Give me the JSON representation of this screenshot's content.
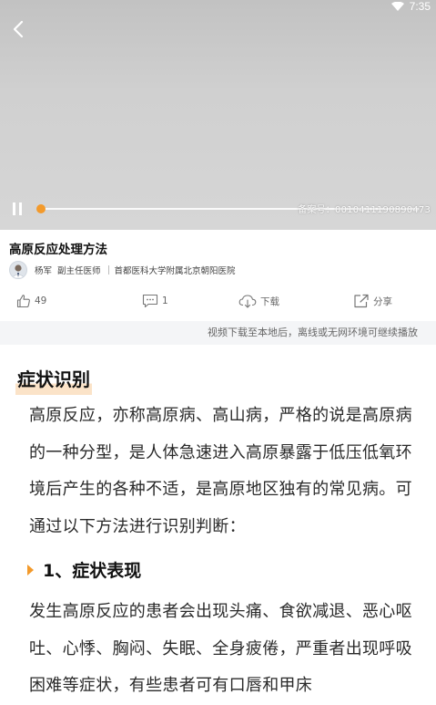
{
  "status_bar": {
    "time": "7:35"
  },
  "player": {
    "record_number": "备案号：0010411190890473",
    "progress_fraction": 0.0,
    "accent_color": "#f39a2b"
  },
  "video": {
    "title": "高原反应处理方法"
  },
  "author": {
    "name": "杨军",
    "title": "副主任医师",
    "hospital": "首都医科大学附属北京朝阳医院"
  },
  "actions": {
    "likes": "49",
    "comments": "1",
    "download_label": "下载",
    "share_label": "分享"
  },
  "tip": "视频下载至本地后，离线或无网环境可继续播放",
  "article": {
    "section_title": "症状识别",
    "paragraph_1": "高原反应，亦称高原病、高山病，严格的说是高原病的一种分型，是人体急速进入高原暴露于低压低氧环境后产生的各种不适，是高原地区独有的常见病。可通过以下方法进行识别判断：",
    "subsection_title": "1、症状表现",
    "paragraph_2": "发生高原反应的患者会出现头痛、食欲减退、恶心呕吐、心悸、胸闷、失眠、全身疲倦，严重者出现呼吸困难等症状，有些患者可有口唇和甲床"
  }
}
